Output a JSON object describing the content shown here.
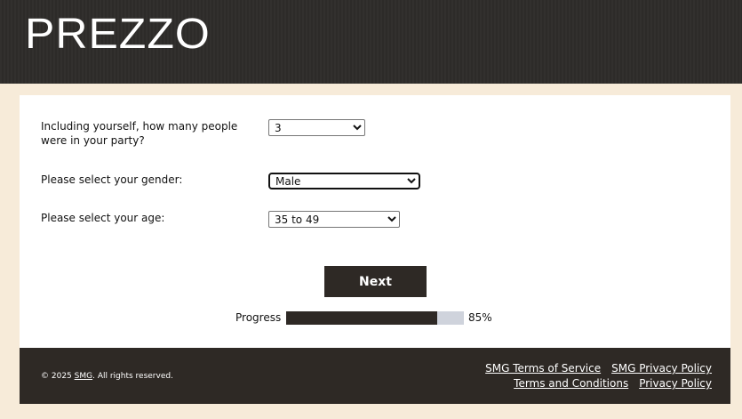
{
  "brand": {
    "logo_text": "PREZZO"
  },
  "questions": {
    "party_size": {
      "label": "Including yourself, how many people were in your party?",
      "selected": "3"
    },
    "gender": {
      "label": "Please select your gender:",
      "selected": "Male"
    },
    "age": {
      "label": "Please select your age:",
      "selected": "35 to 49"
    }
  },
  "actions": {
    "next_label": "Next"
  },
  "progress": {
    "label": "Progress",
    "value_text": "85%",
    "fraction": 0.85
  },
  "footer": {
    "copyright_prefix": "© 2025 ",
    "copyright_link": "SMG",
    "copyright_suffix": ". All rights reserved.",
    "links_row1": [
      "SMG Terms of Service",
      "SMG Privacy Policy"
    ],
    "links_row2": [
      "Terms and Conditions",
      "Privacy Policy"
    ]
  },
  "colors": {
    "header_bg": "#2e2c2a",
    "page_bg": "#f7ebd9",
    "button_bg": "#2e2925",
    "progress_track": "#cfd3dc"
  }
}
